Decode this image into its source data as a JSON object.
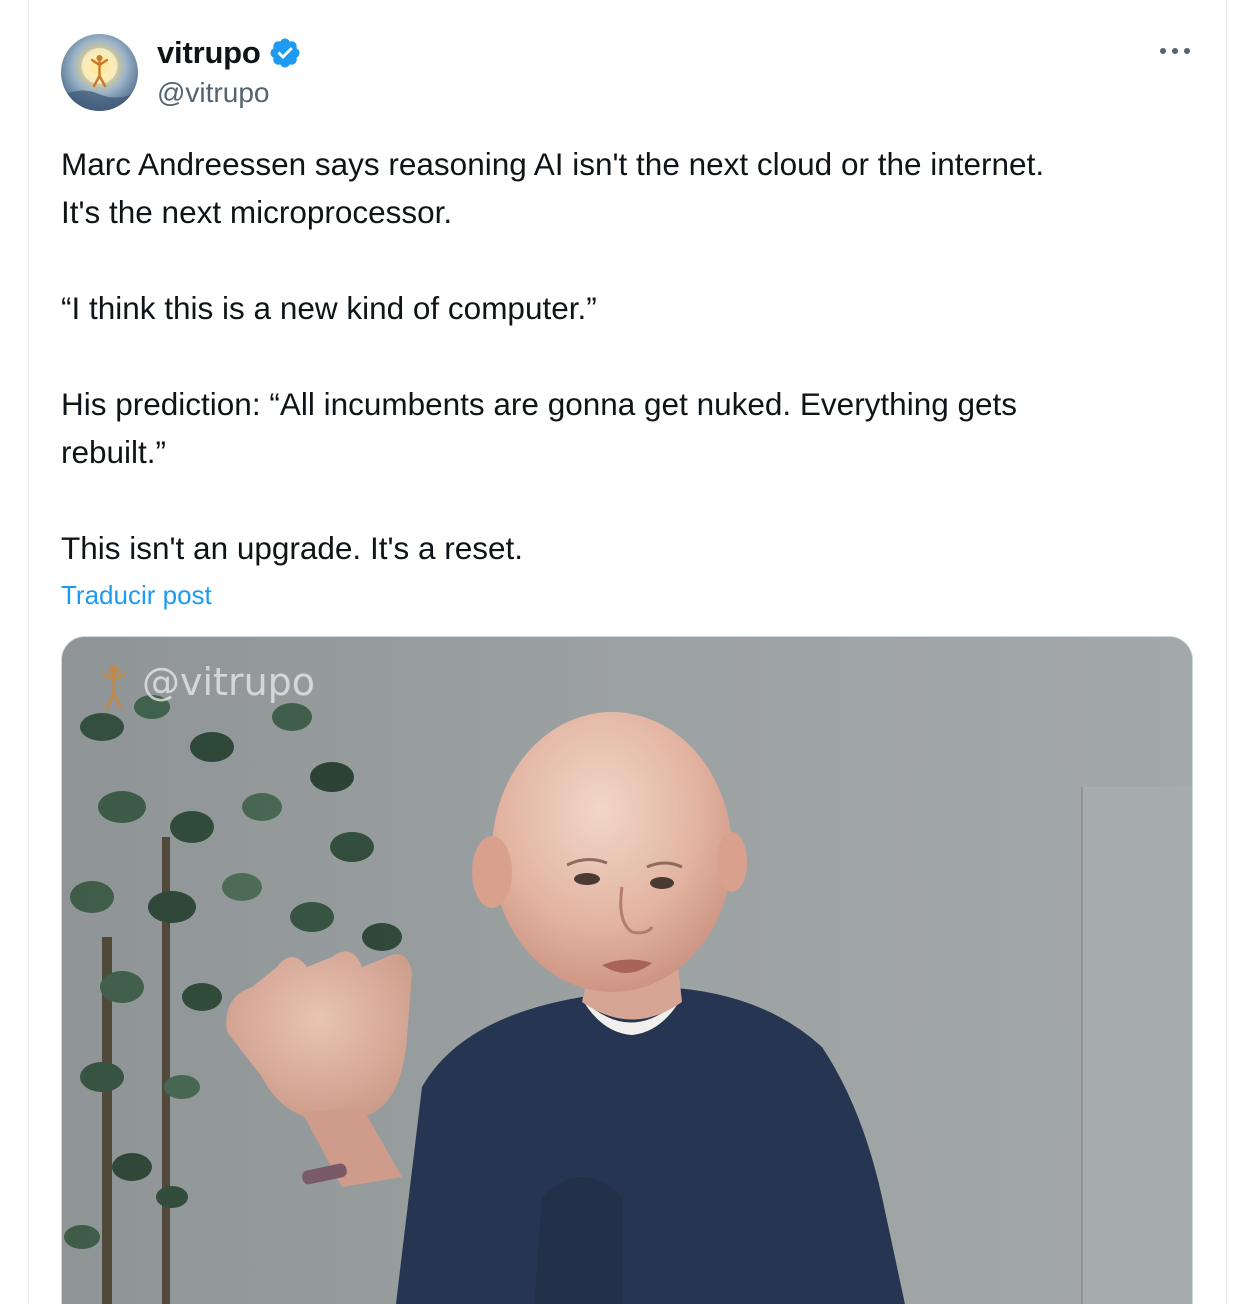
{
  "author": {
    "display_name": "vitrupo",
    "handle": "@vitrupo",
    "verified": true,
    "avatar_icon": "avatar-figure-icon"
  },
  "menu": {
    "more_icon": "more-horizontal-icon"
  },
  "tweet": {
    "paragraphs": [
      "Marc Andreessen says reasoning AI isn't the next cloud or the internet.\nIt's the next microprocessor.",
      "“I think this is a new kind of computer.”",
      "His prediction: “All incumbents are gonna get nuked. Everything gets\nrebuilt.”",
      "This isn't an upgrade. It's a reset."
    ],
    "translate_label": "Traducir post"
  },
  "media": {
    "type": "video",
    "watermark": "@vitrupo"
  },
  "colors": {
    "text": "#0f1419",
    "secondary": "#536471",
    "link": "#1d9bf0",
    "verified": "#1d9bf0",
    "border": "#cfd9de"
  }
}
